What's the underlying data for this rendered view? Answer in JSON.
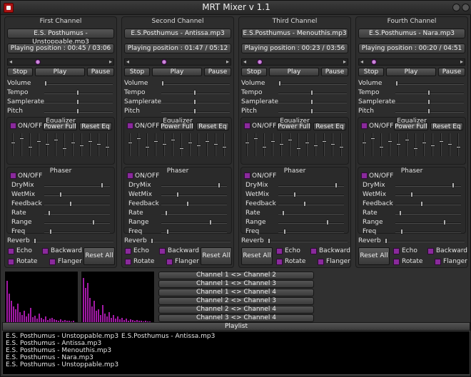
{
  "window": {
    "title": "MRT Mixer v 1.1"
  },
  "labels": {
    "stop": "Stop",
    "play": "Play",
    "pause": "Pause",
    "volume": "Volume",
    "tempo": "Tempo",
    "samplerate": "Samplerate",
    "pitch": "Pitch",
    "equalizer": "Equalizer",
    "on_off": "ON/OFF",
    "power_full": "Power Full",
    "reset_eq": "Reset Eq",
    "phaser": "Phaser",
    "drymix": "DryMix",
    "wetmix": "WetMix",
    "feedback": "Feedback",
    "rate": "Rate",
    "range": "Range",
    "freq": "Freq",
    "reverb": "Reverb",
    "echo": "Echo",
    "backward": "Backward",
    "rotate": "Rotate",
    "flanger": "Flanger",
    "reset_all": "Reset All"
  },
  "channels": [
    {
      "title": "First Channel",
      "file": "E.S. Posthumus - Unstoppable.mp3",
      "position": "Playing position : 00:45 / 03:06",
      "progress": 0.24
    },
    {
      "title": "Second Channel",
      "file": "E.S.Posthumus - Antissa.mp3",
      "position": "Playing position : 01:47 / 05:12",
      "progress": 0.34
    },
    {
      "title": "Third Channel",
      "file": "E.S.Posthumus - Menouthis.mp3",
      "position": "Playing position : 00:23 / 03:56",
      "progress": 0.1
    },
    {
      "title": "Fourth Channel",
      "file": "E.S.Posthumus - Nara.mp3",
      "position": "Playing position : 00:20 / 04:51",
      "progress": 0.07
    }
  ],
  "swaps": [
    "Channel 1 <> Channel 2",
    "Channel 1 <> Channel 3",
    "Channel 1 <> Channel 4",
    "Channel 2 <> Channel 3",
    "Channel 2 <> Channel 4",
    "Channel 3 <> Channel 4"
  ],
  "playlist": {
    "header": "Playlist",
    "col1": [
      "E.S. Posthumus - Unstoppable.mp3",
      "E.S. Posthumus - Antissa.mp3",
      "E.S. Posthumus - Menouthis.mp3",
      "E.S. Posthumus - Nara.mp3",
      "E.S. Posthumus - Unstoppable.mp3"
    ],
    "col2": [
      "E.S.Posthumus - Antissa.mp3"
    ]
  },
  "colors": {
    "accent": "#8a2a9c",
    "spectrum": "#a21aa6"
  }
}
